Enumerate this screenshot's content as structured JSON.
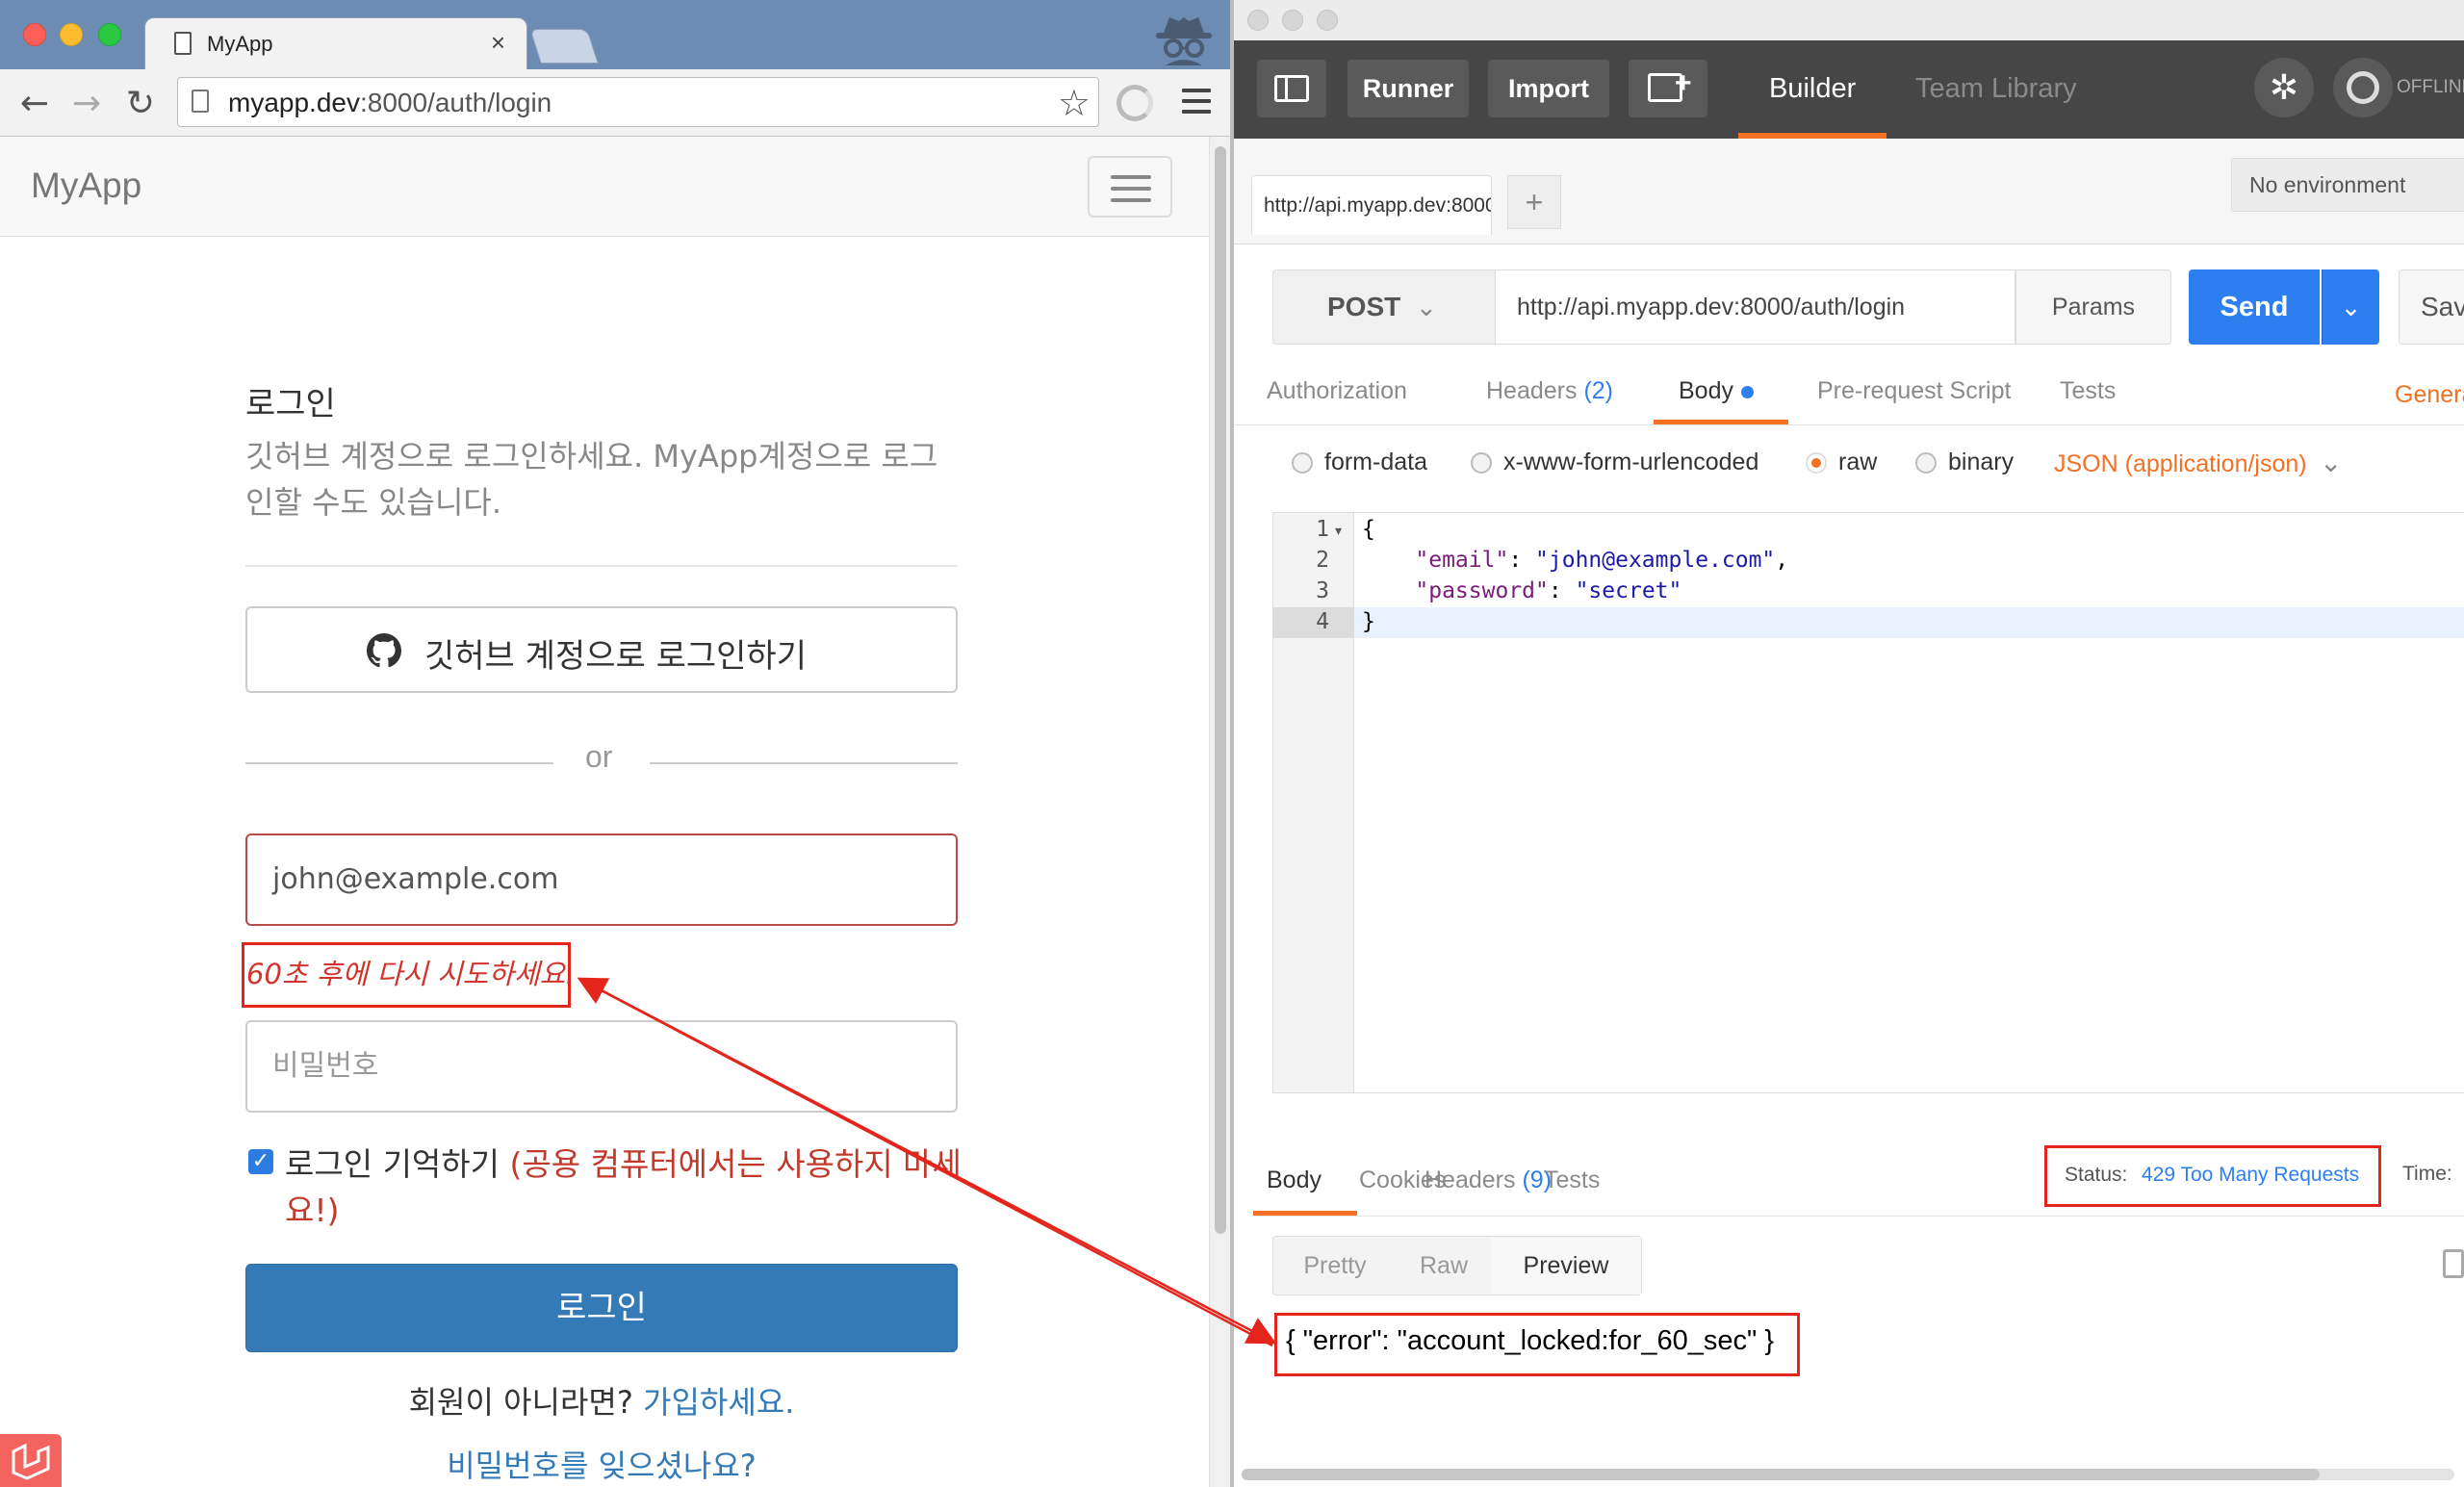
{
  "browser": {
    "tab_title": "MyApp",
    "tab_close": "×",
    "url_host": "myapp.dev",
    "url_rest": ":8000/auth/login",
    "page": {
      "brand": "MyApp",
      "login_title": "로그인",
      "login_desc": "깃허브 계정으로 로그인하세요. MyApp계정으로 로그인할 수도 있습니다.",
      "github_button": "깃허브 계정으로 로그인하기",
      "or": "or",
      "email_value": "john@example.com",
      "email_error": "60초 후에 다시 시도하세요.",
      "password_placeholder": "비밀번호",
      "remember_label": "로그인 기억하기",
      "remember_warning": "(공용 컴퓨터에서는 사용하지 마세요!)",
      "login_button": "로그인",
      "signup_prompt": "회원이 아니라면?",
      "signup_link": "가입하세요.",
      "forgot_link": "비밀번호를 잊으셨나요?"
    }
  },
  "postman": {
    "header": {
      "runner": "Runner",
      "import": "Import",
      "builder": "Builder",
      "team_library": "Team Library",
      "offline": "OFFLINE"
    },
    "request_tab": "http://api.myapp.dev:8000",
    "add_tab": "+",
    "environment": "No environment",
    "method": "POST",
    "url": "http://api.myapp.dev:8000/auth/login",
    "params": "Params",
    "send": "Send",
    "save": "Sav",
    "subtabs": {
      "authorization": "Authorization",
      "headers": "Headers",
      "headers_count": "(2)",
      "body": "Body",
      "prerequest": "Pre-request Script",
      "tests": "Tests",
      "generate": "Genera"
    },
    "body_modes": {
      "form_data": "form-data",
      "urlencoded": "x-www-form-urlencoded",
      "raw": "raw",
      "binary": "binary",
      "content_type": "JSON (application/json)"
    },
    "code": {
      "line1": "{",
      "key_email": "\"email\"",
      "val_email": "\"john@example.com\"",
      "key_password": "\"password\"",
      "val_password": "\"secret\"",
      "line4": "}",
      "line_numbers": [
        "1",
        "2",
        "3",
        "4"
      ]
    },
    "response": {
      "tabs": {
        "body": "Body",
        "cookies": "Cookies",
        "headers": "Headers",
        "headers_count": "(9)",
        "tests": "Tests"
      },
      "status_label": "Status:",
      "status_value": "429 Too Many Requests",
      "time_label": "Time:",
      "views": {
        "pretty": "Pretty",
        "raw": "Raw",
        "preview": "Preview"
      },
      "body_text": "{ \"error\": \"account_locked:for_60_sec\" }"
    }
  },
  "colors": {
    "annotation_red": "#e3251c",
    "postman_orange": "#f47023",
    "send_blue": "#2d7ff0",
    "bootstrap_primary": "#337ab7"
  }
}
